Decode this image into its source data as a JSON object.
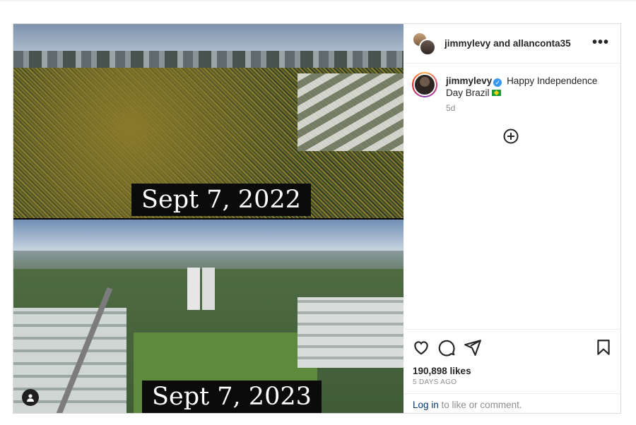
{
  "post": {
    "captions": {
      "top": "Sept 7, 2022",
      "bottom": "Sept 7, 2023"
    },
    "header": {
      "owner1": "jimmylevy",
      "conjunction": "and",
      "owner2": "allanconta35",
      "more_label": "•••"
    },
    "comment": {
      "username": "jimmylevy",
      "verified_mark": "✓",
      "text": "Happy Independence Day Brazil",
      "age": "5d"
    },
    "likes": "190,898 likes",
    "date": "5 DAYS AGO",
    "login_link": "Log in",
    "login_suffix": " to like or comment."
  },
  "icons": {
    "user_tag": "user-tag-icon",
    "add_comment": "plus-circle-icon",
    "like": "heart-icon",
    "comment": "speech-bubble-icon",
    "share": "paper-plane-icon",
    "save": "bookmark-icon",
    "flag": "brazil-flag-icon"
  },
  "colors": {
    "verified": "#3897f0",
    "link": "#00376b",
    "muted": "#8e8e8e"
  }
}
